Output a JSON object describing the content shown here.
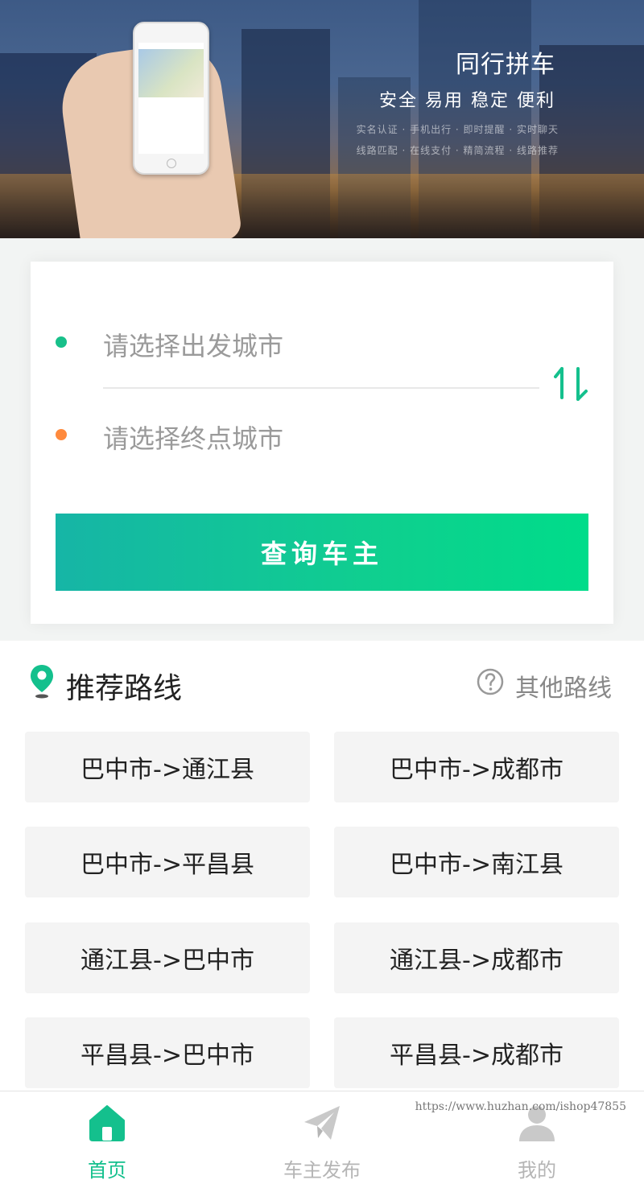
{
  "banner": {
    "title": "同行拼车",
    "subtitle": "安全 易用 稳定 便利",
    "tags_line1": "实名认证  · 手机出行 · 即时提醒 · 实时聊天",
    "tags_line2": "线路匹配 · 在线支付 · 精简流程 · 线路推荐"
  },
  "search": {
    "from_placeholder": "请选择出发城市",
    "to_placeholder": "请选择终点城市",
    "query_button": "查询车主"
  },
  "recommended": {
    "title": "推荐路线",
    "other_link": "其他路线",
    "routes": [
      "巴中市->通江县",
      "巴中市->成都市",
      "巴中市->平昌县",
      "巴中市->南江县",
      "通江县->巴中市",
      "通江县->成都市",
      "平昌县->巴中市",
      "平昌县->成都市"
    ]
  },
  "tabbar": {
    "items": [
      {
        "label": "首页",
        "icon": "home-icon"
      },
      {
        "label": "车主发布",
        "icon": "paper-plane-icon"
      },
      {
        "label": "我的",
        "icon": "user-icon"
      }
    ]
  },
  "watermark": "https://www.huzhan.com/ishop47855",
  "colors": {
    "accent": "#14c08d",
    "start_dot": "#18c08a",
    "end_dot": "#ff8a3d",
    "button_gradient_start": "#16b5a6",
    "button_gradient_end": "#00dc8a"
  }
}
